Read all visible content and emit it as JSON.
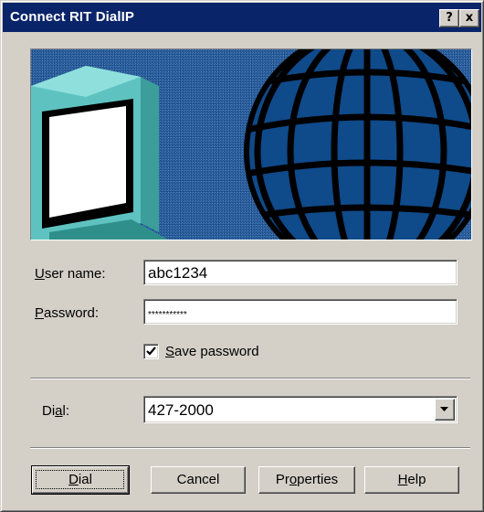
{
  "window": {
    "title": "Connect RIT DialIP",
    "help_glyph": "?",
    "close_glyph": "x"
  },
  "form": {
    "username_label_u": "U",
    "username_label_rest": "ser name:",
    "username_value": "abc1234",
    "password_label_u": "P",
    "password_label_rest": "assword:",
    "password_value": "***********",
    "save_password_u": "S",
    "save_password_rest": "ave password",
    "save_password_checked": true,
    "dial_label_pre": "Di",
    "dial_label_u": "a",
    "dial_label_post": "l:",
    "dial_value": "427-2000"
  },
  "buttons": {
    "dial_u": "D",
    "dial_rest": "ial",
    "cancel": "Cancel",
    "properties_pre": "Pr",
    "properties_u": "o",
    "properties_post": "perties",
    "help_u": "H",
    "help_rest": "elp"
  },
  "colors": {
    "titlebar": "#0a246a",
    "dialog_face": "#d4d0c8",
    "banner_bg": "#1f4f8f",
    "globe": "#0f4a8a",
    "monitor": "#5ec3c0"
  },
  "icons": {
    "help": "question-mark-icon",
    "close": "close-icon",
    "check": "checkmark-icon",
    "dropdown": "chevron-down-icon"
  }
}
